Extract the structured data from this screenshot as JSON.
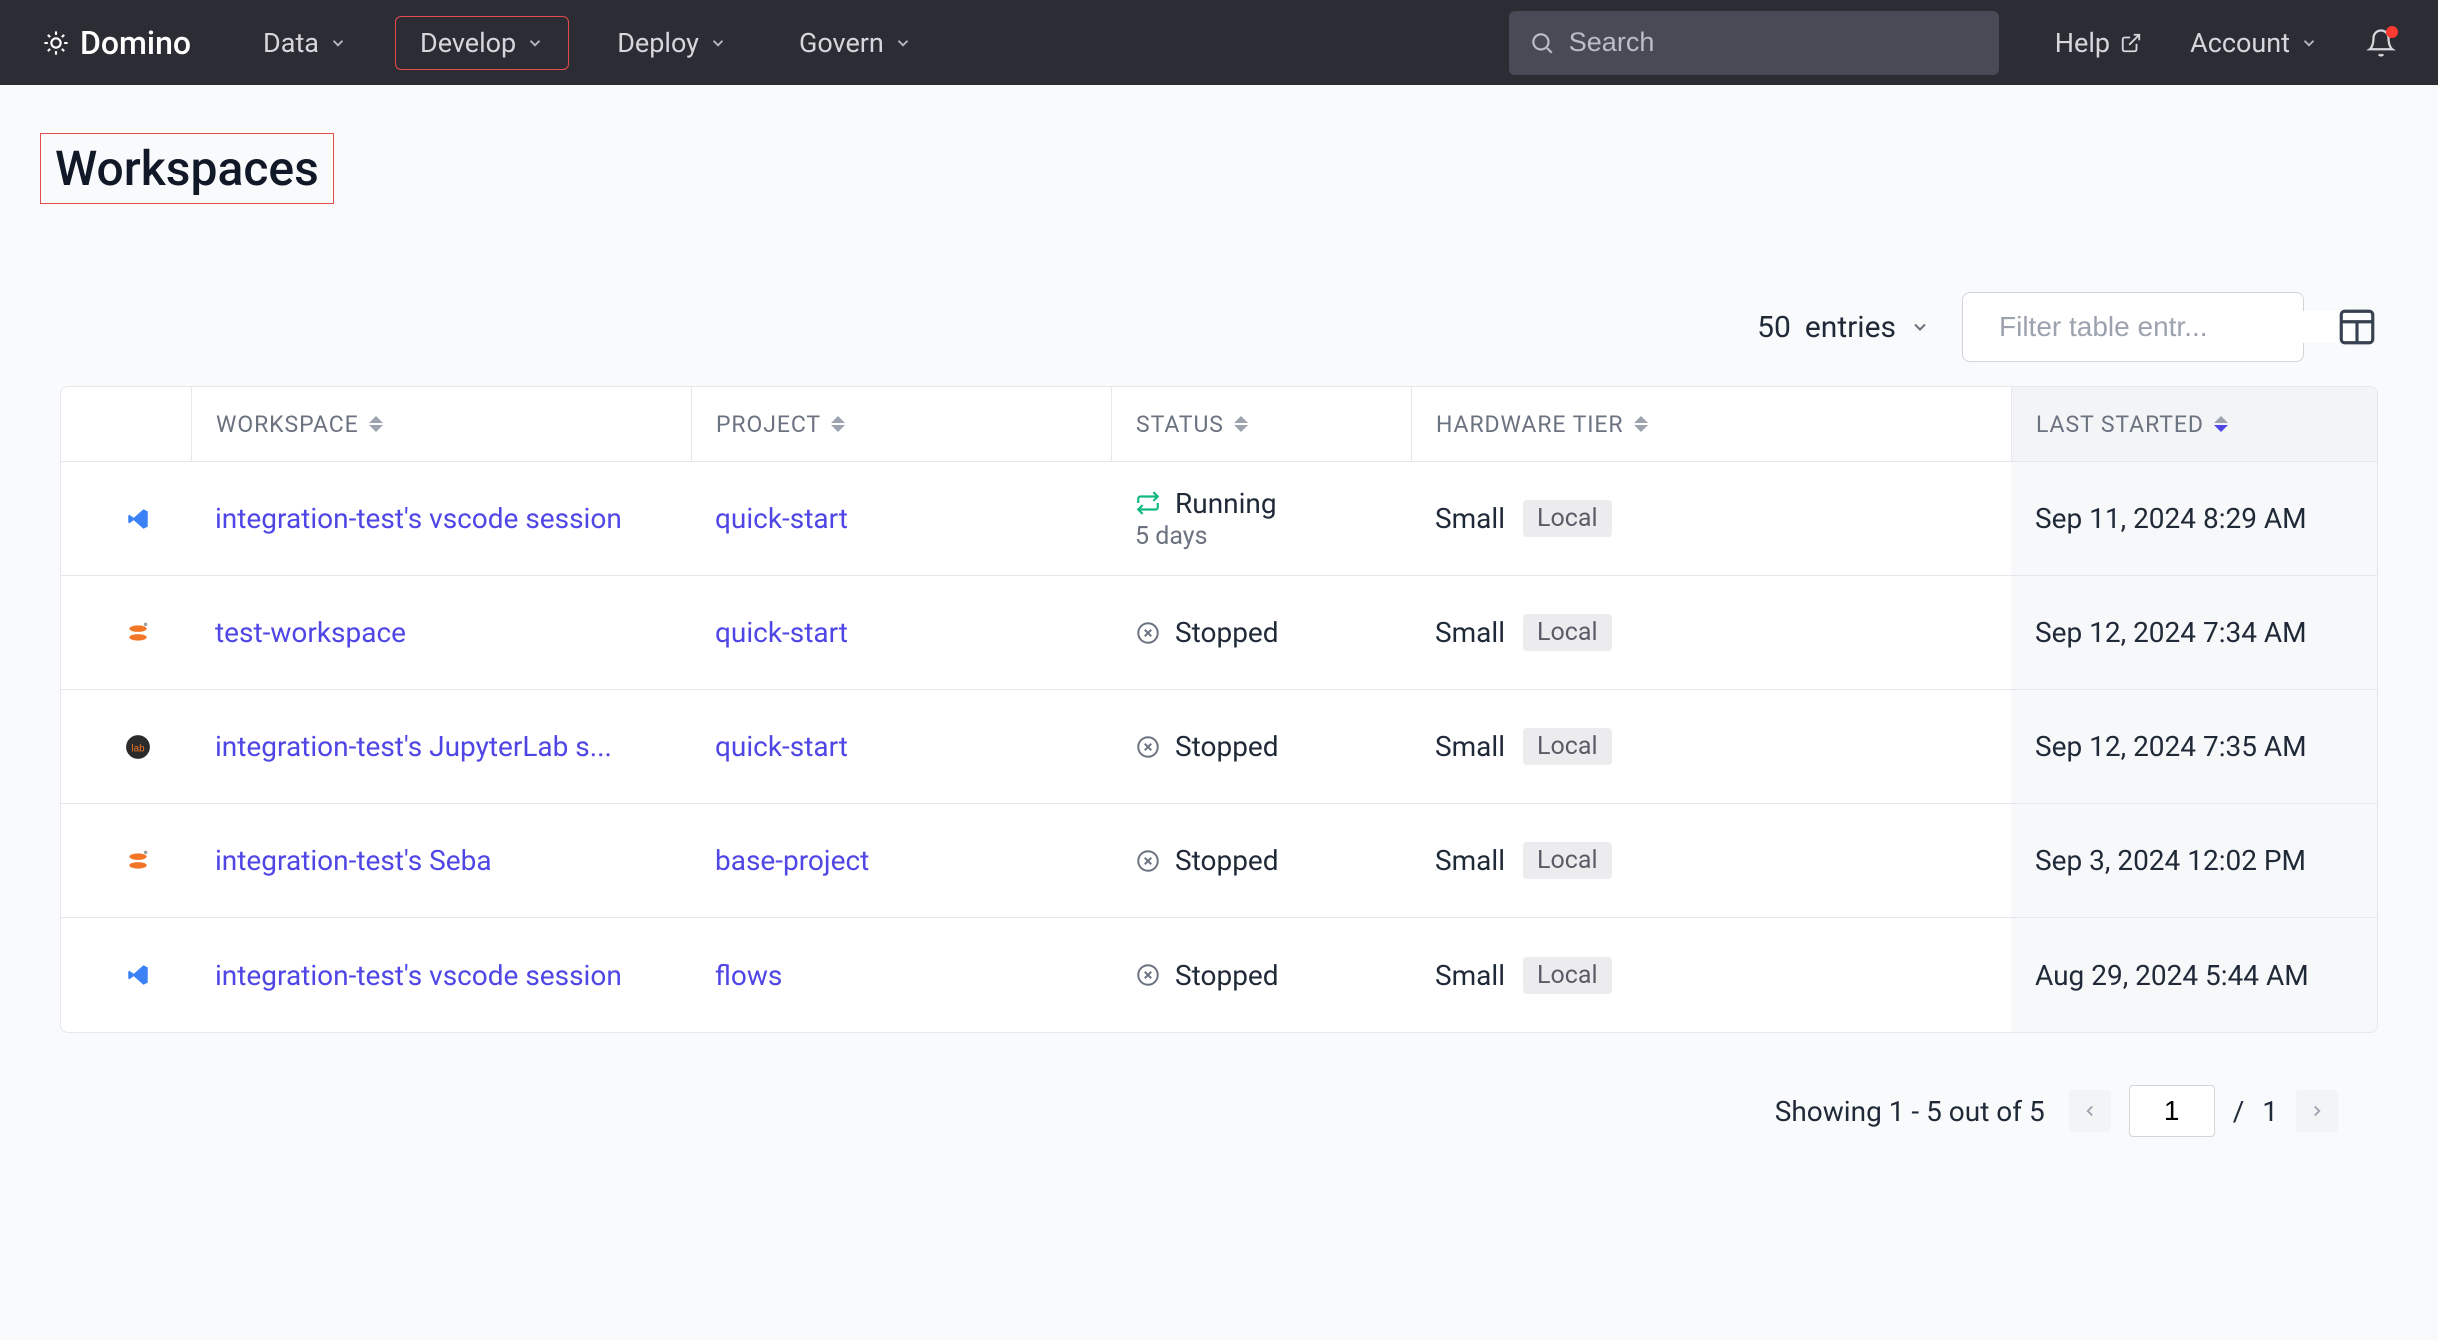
{
  "brand": "Domino",
  "nav": {
    "items": [
      {
        "label": "Data"
      },
      {
        "label": "Develop"
      },
      {
        "label": "Deploy"
      },
      {
        "label": "Govern"
      }
    ],
    "active_index": 1
  },
  "search": {
    "placeholder": "Search"
  },
  "help": "Help",
  "account": "Account",
  "page_title": "Workspaces",
  "entries": {
    "count": "50",
    "label": "entries"
  },
  "filter": {
    "placeholder": "Filter table entr..."
  },
  "columns": {
    "workspace": "WORKSPACE",
    "project": "PROJECT",
    "status": "STATUS",
    "hardware": "HARDWARE TIER",
    "last_started": "LAST STARTED"
  },
  "rows": [
    {
      "icon": "vscode",
      "workspace": "integration-test's vscode session",
      "project": "quick-start",
      "status": "Running",
      "status_kind": "running",
      "status_sub": "5 days",
      "hardware": "Small",
      "hardware_tag": "Local",
      "last_started": "Sep 11, 2024 8:29 AM"
    },
    {
      "icon": "jupyter",
      "workspace": "test-workspace",
      "project": "quick-start",
      "status": "Stopped",
      "status_kind": "stopped",
      "status_sub": "",
      "hardware": "Small",
      "hardware_tag": "Local",
      "last_started": "Sep 12, 2024 7:34 AM"
    },
    {
      "icon": "jupyterlab",
      "workspace": "integration-test's JupyterLab s...",
      "project": "quick-start",
      "status": "Stopped",
      "status_kind": "stopped",
      "status_sub": "",
      "hardware": "Small",
      "hardware_tag": "Local",
      "last_started": "Sep 12, 2024 7:35 AM"
    },
    {
      "icon": "jupyter",
      "workspace": "integration-test's Seba",
      "project": "base-project",
      "status": "Stopped",
      "status_kind": "stopped",
      "status_sub": "",
      "hardware": "Small",
      "hardware_tag": "Local",
      "last_started": "Sep 3, 2024 12:02 PM"
    },
    {
      "icon": "vscode",
      "workspace": "integration-test's vscode session",
      "project": "flows",
      "status": "Stopped",
      "status_kind": "stopped",
      "status_sub": "",
      "hardware": "Small",
      "hardware_tag": "Local",
      "last_started": "Aug 29, 2024 5:44 AM"
    }
  ],
  "footer": {
    "showing": "Showing 1 - 5 out of 5",
    "page": "1",
    "total_pages": "1",
    "sep": "/"
  }
}
